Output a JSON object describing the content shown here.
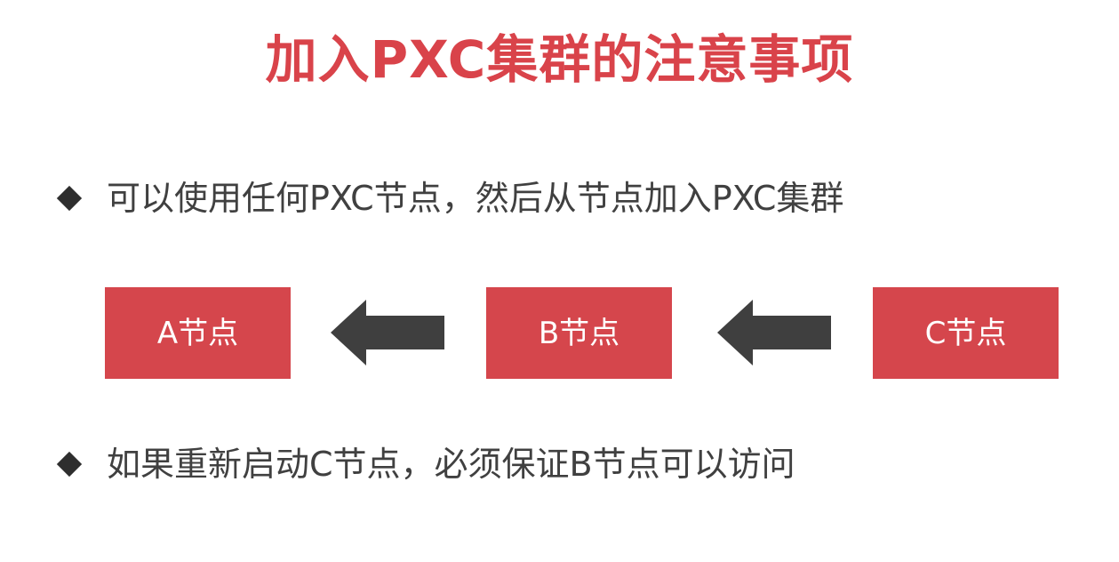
{
  "title": "加入PXC集群的注意事项",
  "bullets": [
    "可以使用任何PXC节点，然后从节点加入PXC集群",
    "如果重新启动C节点，必须保证B节点可以访问"
  ],
  "nodes": {
    "a": "A节点",
    "b": "B节点",
    "c": "C节点"
  },
  "colors": {
    "title": "#d9434a",
    "node_fill": "#d5464c",
    "arrow": "#3f3f3f",
    "text": "#404040"
  },
  "icons": {
    "bullet": "diamond-bullet-icon",
    "arrow": "left-arrow-icon"
  }
}
